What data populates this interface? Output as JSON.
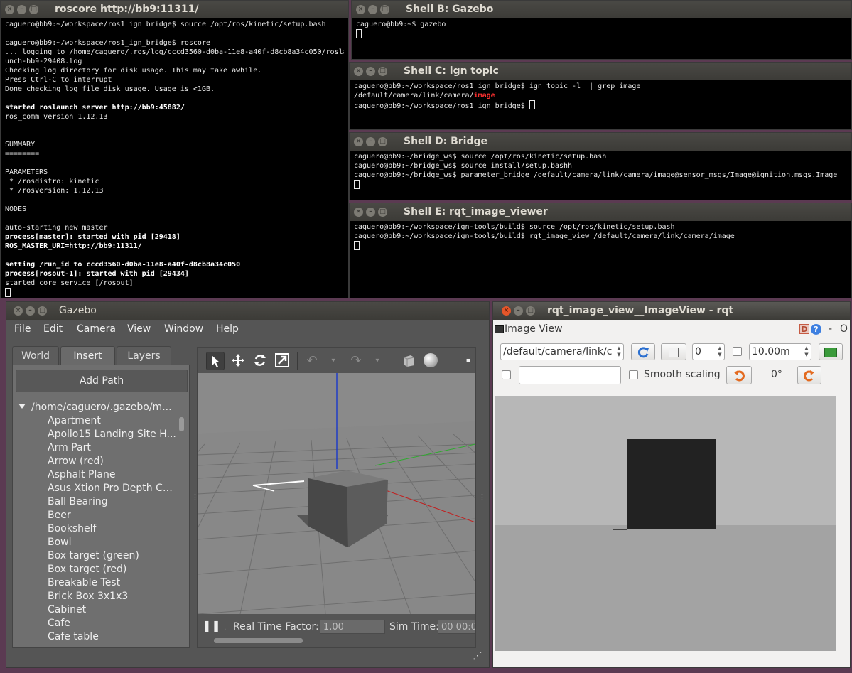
{
  "roscore": {
    "title": "roscore http://bb9:11311/",
    "lines": [
      {
        "t": "caguero@bb9:~/workspace/ros1_ign_bridge$ source /opt/ros/kinetic/setup.bash",
        "b": false
      },
      {
        "t": "",
        "b": false
      },
      {
        "t": "caguero@bb9:~/workspace/ros1_ign_bridge$ roscore",
        "b": false
      },
      {
        "t": "... logging to /home/caguero/.ros/log/cccd3560-d0ba-11e8-a40f-d8cb8a34c050/rosla",
        "b": false
      },
      {
        "t": "unch-bb9-29408.log",
        "b": false
      },
      {
        "t": "Checking log directory for disk usage. This may take awhile.",
        "b": false
      },
      {
        "t": "Press Ctrl-C to interrupt",
        "b": false
      },
      {
        "t": "Done checking log file disk usage. Usage is <1GB.",
        "b": false
      },
      {
        "t": "",
        "b": false
      },
      {
        "t": "started roslaunch server http://bb9:45882/",
        "b": true
      },
      {
        "t": "ros_comm version 1.12.13",
        "b": false
      },
      {
        "t": "",
        "b": false
      },
      {
        "t": "",
        "b": false
      },
      {
        "t": "SUMMARY",
        "b": false
      },
      {
        "t": "========",
        "b": false
      },
      {
        "t": "",
        "b": false
      },
      {
        "t": "PARAMETERS",
        "b": false
      },
      {
        "t": " * /rosdistro: kinetic",
        "b": false
      },
      {
        "t": " * /rosversion: 1.12.13",
        "b": false
      },
      {
        "t": "",
        "b": false
      },
      {
        "t": "NODES",
        "b": false
      },
      {
        "t": "",
        "b": false
      },
      {
        "t": "auto-starting new master",
        "b": false
      },
      {
        "t": "process[master]: started with pid [29418]",
        "b": true
      },
      {
        "t": "ROS_MASTER_URI=http://bb9:11311/",
        "b": true
      },
      {
        "t": "",
        "b": false
      },
      {
        "t": "setting /run_id to cccd3560-d0ba-11e8-a40f-d8cb8a34c050",
        "b": true
      },
      {
        "t": "process[rosout-1]: started with pid [29434]",
        "b": true
      },
      {
        "t": "started core service [/rosout]",
        "b": false
      }
    ]
  },
  "shell_b": {
    "title": "Shell B: Gazebo",
    "lines": [
      "caguero@bb9:~$ gazebo"
    ]
  },
  "shell_c": {
    "title": "Shell C: ign topic",
    "line1": "caguero@bb9:~/workspace/ros1_ign_bridge$ ign topic -l  | grep image",
    "line2_prefix": "/default/camera/link/camera/",
    "line2_highlight": "image",
    "line3": "caguero@bb9:~/workspace/ros1_ign_bridge$ "
  },
  "shell_d": {
    "title": "Shell D: Bridge",
    "lines": [
      "caguero@bb9:~/bridge_ws$ source /opt/ros/kinetic/setup.bash",
      "caguero@bb9:~/bridge_ws$ source install/setup.bashh",
      "caguero@bb9:~/bridge_ws$ parameter_bridge /default/camera/link/camera/image@sensor_msgs/Image@ignition.msgs.Image"
    ]
  },
  "shell_e": {
    "title": "Shell E: rqt_image_viewer",
    "lines": [
      "caguero@bb9:~/workspace/ign-tools/build$ source /opt/ros/kinetic/setup.bash",
      "caguero@bb9:~/workspace/ign-tools/build$ rqt_image_view /default/camera/link/camera/image"
    ]
  },
  "gazebo": {
    "title": "Gazebo",
    "menus": [
      "File",
      "Edit",
      "Camera",
      "View",
      "Window",
      "Help"
    ],
    "tabs": [
      "World",
      "Insert",
      "Layers"
    ],
    "add_path": "Add Path",
    "tree_root": "/home/caguero/.gazebo/m...",
    "models": [
      "Apartment",
      "Apollo15 Landing Site H...",
      "Arm Part",
      "Arrow (red)",
      "Asphalt Plane",
      "Asus Xtion Pro Depth Ca...",
      "Ball Bearing",
      "Beer",
      "Bookshelf",
      "Bowl",
      "Box target (green)",
      "Box target (red)",
      "Breakable Test",
      "Brick Box 3x1x3",
      "Cabinet",
      "Cafe",
      "Cafe table"
    ],
    "rtf_label": "Real Time Factor:",
    "rtf_value": "1.00",
    "sim_time_label": "Sim Time:",
    "sim_time_value": "00 00:0"
  },
  "rqt": {
    "title": "rqt_image_view__ImageView - rqt",
    "panel_title": "Image View",
    "topic": "/default/camera/link/c",
    "spin_value": "0",
    "timeout": "10.00m",
    "smooth_scaling": "Smooth scaling",
    "rotation": "0°",
    "dock_label": "D",
    "help_label": "?",
    "dash": "-",
    "float_label": "O"
  }
}
